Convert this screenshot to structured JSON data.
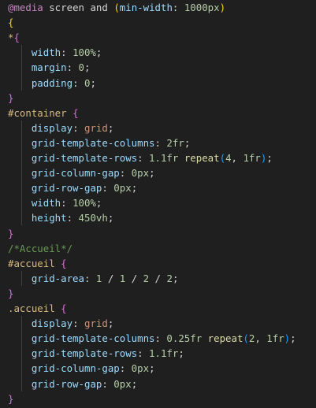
{
  "editor": {
    "language": "css",
    "lines": [
      [
        {
          "t": "@media",
          "c": "at"
        },
        {
          "t": " screen ",
          "c": "plain"
        },
        {
          "t": "and",
          "c": "plain"
        },
        {
          "t": " ",
          "c": "plain"
        },
        {
          "t": "(",
          "c": "brace-1"
        },
        {
          "t": "min-width",
          "c": "prop"
        },
        {
          "t": ": ",
          "c": "plain"
        },
        {
          "t": "1000px",
          "c": "num"
        },
        {
          "t": ")",
          "c": "brace-1"
        }
      ],
      [
        {
          "t": "{",
          "c": "brace-1"
        }
      ],
      [
        {
          "t": "*",
          "c": "universal"
        },
        {
          "t": "{",
          "c": "brace-2"
        }
      ],
      [
        {
          "t": "    ",
          "c": "plain"
        },
        {
          "t": "width",
          "c": "prop"
        },
        {
          "t": ": ",
          "c": "plain"
        },
        {
          "t": "100%",
          "c": "num"
        },
        {
          "t": ";",
          "c": "plain"
        }
      ],
      [
        {
          "t": "    ",
          "c": "plain"
        },
        {
          "t": "margin",
          "c": "prop"
        },
        {
          "t": ": ",
          "c": "plain"
        },
        {
          "t": "0",
          "c": "num"
        },
        {
          "t": ";",
          "c": "plain"
        }
      ],
      [
        {
          "t": "    ",
          "c": "plain"
        },
        {
          "t": "padding",
          "c": "prop"
        },
        {
          "t": ": ",
          "c": "plain"
        },
        {
          "t": "0",
          "c": "num"
        },
        {
          "t": ";",
          "c": "plain"
        }
      ],
      [
        {
          "t": "}",
          "c": "brace-2"
        }
      ],
      [
        {
          "t": "#container",
          "c": "selector"
        },
        {
          "t": " ",
          "c": "plain"
        },
        {
          "t": "{",
          "c": "brace-2"
        }
      ],
      [
        {
          "t": "    ",
          "c": "plain"
        },
        {
          "t": "display",
          "c": "prop"
        },
        {
          "t": ": ",
          "c": "plain"
        },
        {
          "t": "grid",
          "c": "value"
        },
        {
          "t": ";",
          "c": "plain"
        }
      ],
      [
        {
          "t": "    ",
          "c": "plain"
        },
        {
          "t": "grid-template-columns",
          "c": "prop"
        },
        {
          "t": ": ",
          "c": "plain"
        },
        {
          "t": "2fr",
          "c": "num"
        },
        {
          "t": ";",
          "c": "plain"
        }
      ],
      [
        {
          "t": "    ",
          "c": "plain"
        },
        {
          "t": "grid-template-rows",
          "c": "prop"
        },
        {
          "t": ": ",
          "c": "plain"
        },
        {
          "t": "1.1fr",
          "c": "num"
        },
        {
          "t": " ",
          "c": "plain"
        },
        {
          "t": "repeat",
          "c": "fn"
        },
        {
          "t": "(",
          "c": "brace-3"
        },
        {
          "t": "4",
          "c": "num"
        },
        {
          "t": ", ",
          "c": "plain"
        },
        {
          "t": "1fr",
          "c": "num"
        },
        {
          "t": ")",
          "c": "brace-3"
        },
        {
          "t": ";",
          "c": "plain"
        }
      ],
      [
        {
          "t": "    ",
          "c": "plain"
        },
        {
          "t": "grid-column-gap",
          "c": "prop"
        },
        {
          "t": ": ",
          "c": "plain"
        },
        {
          "t": "0px",
          "c": "num"
        },
        {
          "t": ";",
          "c": "plain"
        }
      ],
      [
        {
          "t": "    ",
          "c": "plain"
        },
        {
          "t": "grid-row-gap",
          "c": "prop"
        },
        {
          "t": ": ",
          "c": "plain"
        },
        {
          "t": "0px",
          "c": "num"
        },
        {
          "t": ";",
          "c": "plain"
        }
      ],
      [
        {
          "t": "    ",
          "c": "plain"
        },
        {
          "t": "width",
          "c": "prop"
        },
        {
          "t": ": ",
          "c": "plain"
        },
        {
          "t": "100%",
          "c": "num"
        },
        {
          "t": ";",
          "c": "plain"
        }
      ],
      [
        {
          "t": "    ",
          "c": "plain"
        },
        {
          "t": "height",
          "c": "prop"
        },
        {
          "t": ": ",
          "c": "plain"
        },
        {
          "t": "450vh",
          "c": "num"
        },
        {
          "t": ";",
          "c": "plain"
        }
      ],
      [
        {
          "t": "}",
          "c": "brace-2"
        }
      ],
      [
        {
          "t": "/*Accueil*/",
          "c": "comment"
        }
      ],
      [
        {
          "t": "#accueil",
          "c": "selector"
        },
        {
          "t": " ",
          "c": "plain"
        },
        {
          "t": "{",
          "c": "brace-2"
        }
      ],
      [
        {
          "t": "    ",
          "c": "plain"
        },
        {
          "t": "grid-area",
          "c": "prop"
        },
        {
          "t": ": ",
          "c": "plain"
        },
        {
          "t": "1",
          "c": "num"
        },
        {
          "t": " / ",
          "c": "plain"
        },
        {
          "t": "1",
          "c": "num"
        },
        {
          "t": " / ",
          "c": "plain"
        },
        {
          "t": "2",
          "c": "num"
        },
        {
          "t": " / ",
          "c": "plain"
        },
        {
          "t": "2",
          "c": "num"
        },
        {
          "t": ";",
          "c": "plain"
        }
      ],
      [
        {
          "t": "}",
          "c": "brace-2"
        }
      ],
      [
        {
          "t": ".accueil",
          "c": "selector"
        },
        {
          "t": " ",
          "c": "plain"
        },
        {
          "t": "{",
          "c": "brace-2"
        }
      ],
      [
        {
          "t": "    ",
          "c": "plain"
        },
        {
          "t": "display",
          "c": "prop"
        },
        {
          "t": ": ",
          "c": "plain"
        },
        {
          "t": "grid",
          "c": "value"
        },
        {
          "t": ";",
          "c": "plain"
        }
      ],
      [
        {
          "t": "    ",
          "c": "plain"
        },
        {
          "t": "grid-template-columns",
          "c": "prop"
        },
        {
          "t": ": ",
          "c": "plain"
        },
        {
          "t": "0.25fr",
          "c": "num"
        },
        {
          "t": " ",
          "c": "plain"
        },
        {
          "t": "repeat",
          "c": "fn"
        },
        {
          "t": "(",
          "c": "brace-3"
        },
        {
          "t": "2",
          "c": "num"
        },
        {
          "t": ", ",
          "c": "plain"
        },
        {
          "t": "1fr",
          "c": "num"
        },
        {
          "t": ")",
          "c": "brace-3"
        },
        {
          "t": ";",
          "c": "plain"
        }
      ],
      [
        {
          "t": "    ",
          "c": "plain"
        },
        {
          "t": "grid-template-rows",
          "c": "prop"
        },
        {
          "t": ": ",
          "c": "plain"
        },
        {
          "t": "1.1fr",
          "c": "num"
        },
        {
          "t": ";",
          "c": "plain"
        }
      ],
      [
        {
          "t": "    ",
          "c": "plain"
        },
        {
          "t": "grid-column-gap",
          "c": "prop"
        },
        {
          "t": ": ",
          "c": "plain"
        },
        {
          "t": "0px",
          "c": "num"
        },
        {
          "t": ";",
          "c": "plain"
        }
      ],
      [
        {
          "t": "    ",
          "c": "plain"
        },
        {
          "t": "grid-row-gap",
          "c": "prop"
        },
        {
          "t": ": ",
          "c": "plain"
        },
        {
          "t": "0px",
          "c": "num"
        },
        {
          "t": ";",
          "c": "plain"
        }
      ],
      [
        {
          "t": "}",
          "c": "brace-2"
        }
      ]
    ]
  },
  "colors": {
    "background": "#1f1f1f",
    "property": "#9cdcfe",
    "number": "#b5cea8",
    "selector": "#d7ba7d",
    "function": "#dcdcaa",
    "string_value": "#ce9178",
    "comment": "#6a9955",
    "at_rule": "#c586c0",
    "bracket_gold": "#ffd700",
    "bracket_orchid": "#da70d6",
    "bracket_blue": "#179fff"
  }
}
